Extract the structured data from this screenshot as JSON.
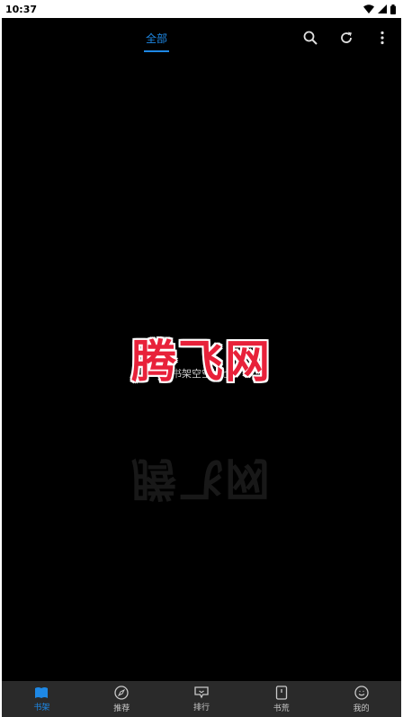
{
  "status_bar": {
    "time": "10:37"
  },
  "app_bar": {
    "tab_label": "全部",
    "actions": [
      "search-icon",
      "refresh-icon",
      "more-vert-icon"
    ]
  },
  "empty_state": {
    "text": "~书架空空如也~"
  },
  "watermark": {
    "text": "腾飞网"
  },
  "bottom_nav": {
    "items": [
      {
        "label": "书架",
        "icon": "bookshelf-icon",
        "active": true
      },
      {
        "label": "推荐",
        "icon": "compass-icon",
        "active": false
      },
      {
        "label": "排行",
        "icon": "ranking-icon",
        "active": false
      },
      {
        "label": "书荒",
        "icon": "book-icon",
        "active": false
      },
      {
        "label": "我的",
        "icon": "profile-icon",
        "active": false
      }
    ]
  },
  "colors": {
    "accent": "#1e88e5",
    "background": "#000000",
    "nav_background": "#2a2a2a",
    "watermark": "#e8213a"
  }
}
